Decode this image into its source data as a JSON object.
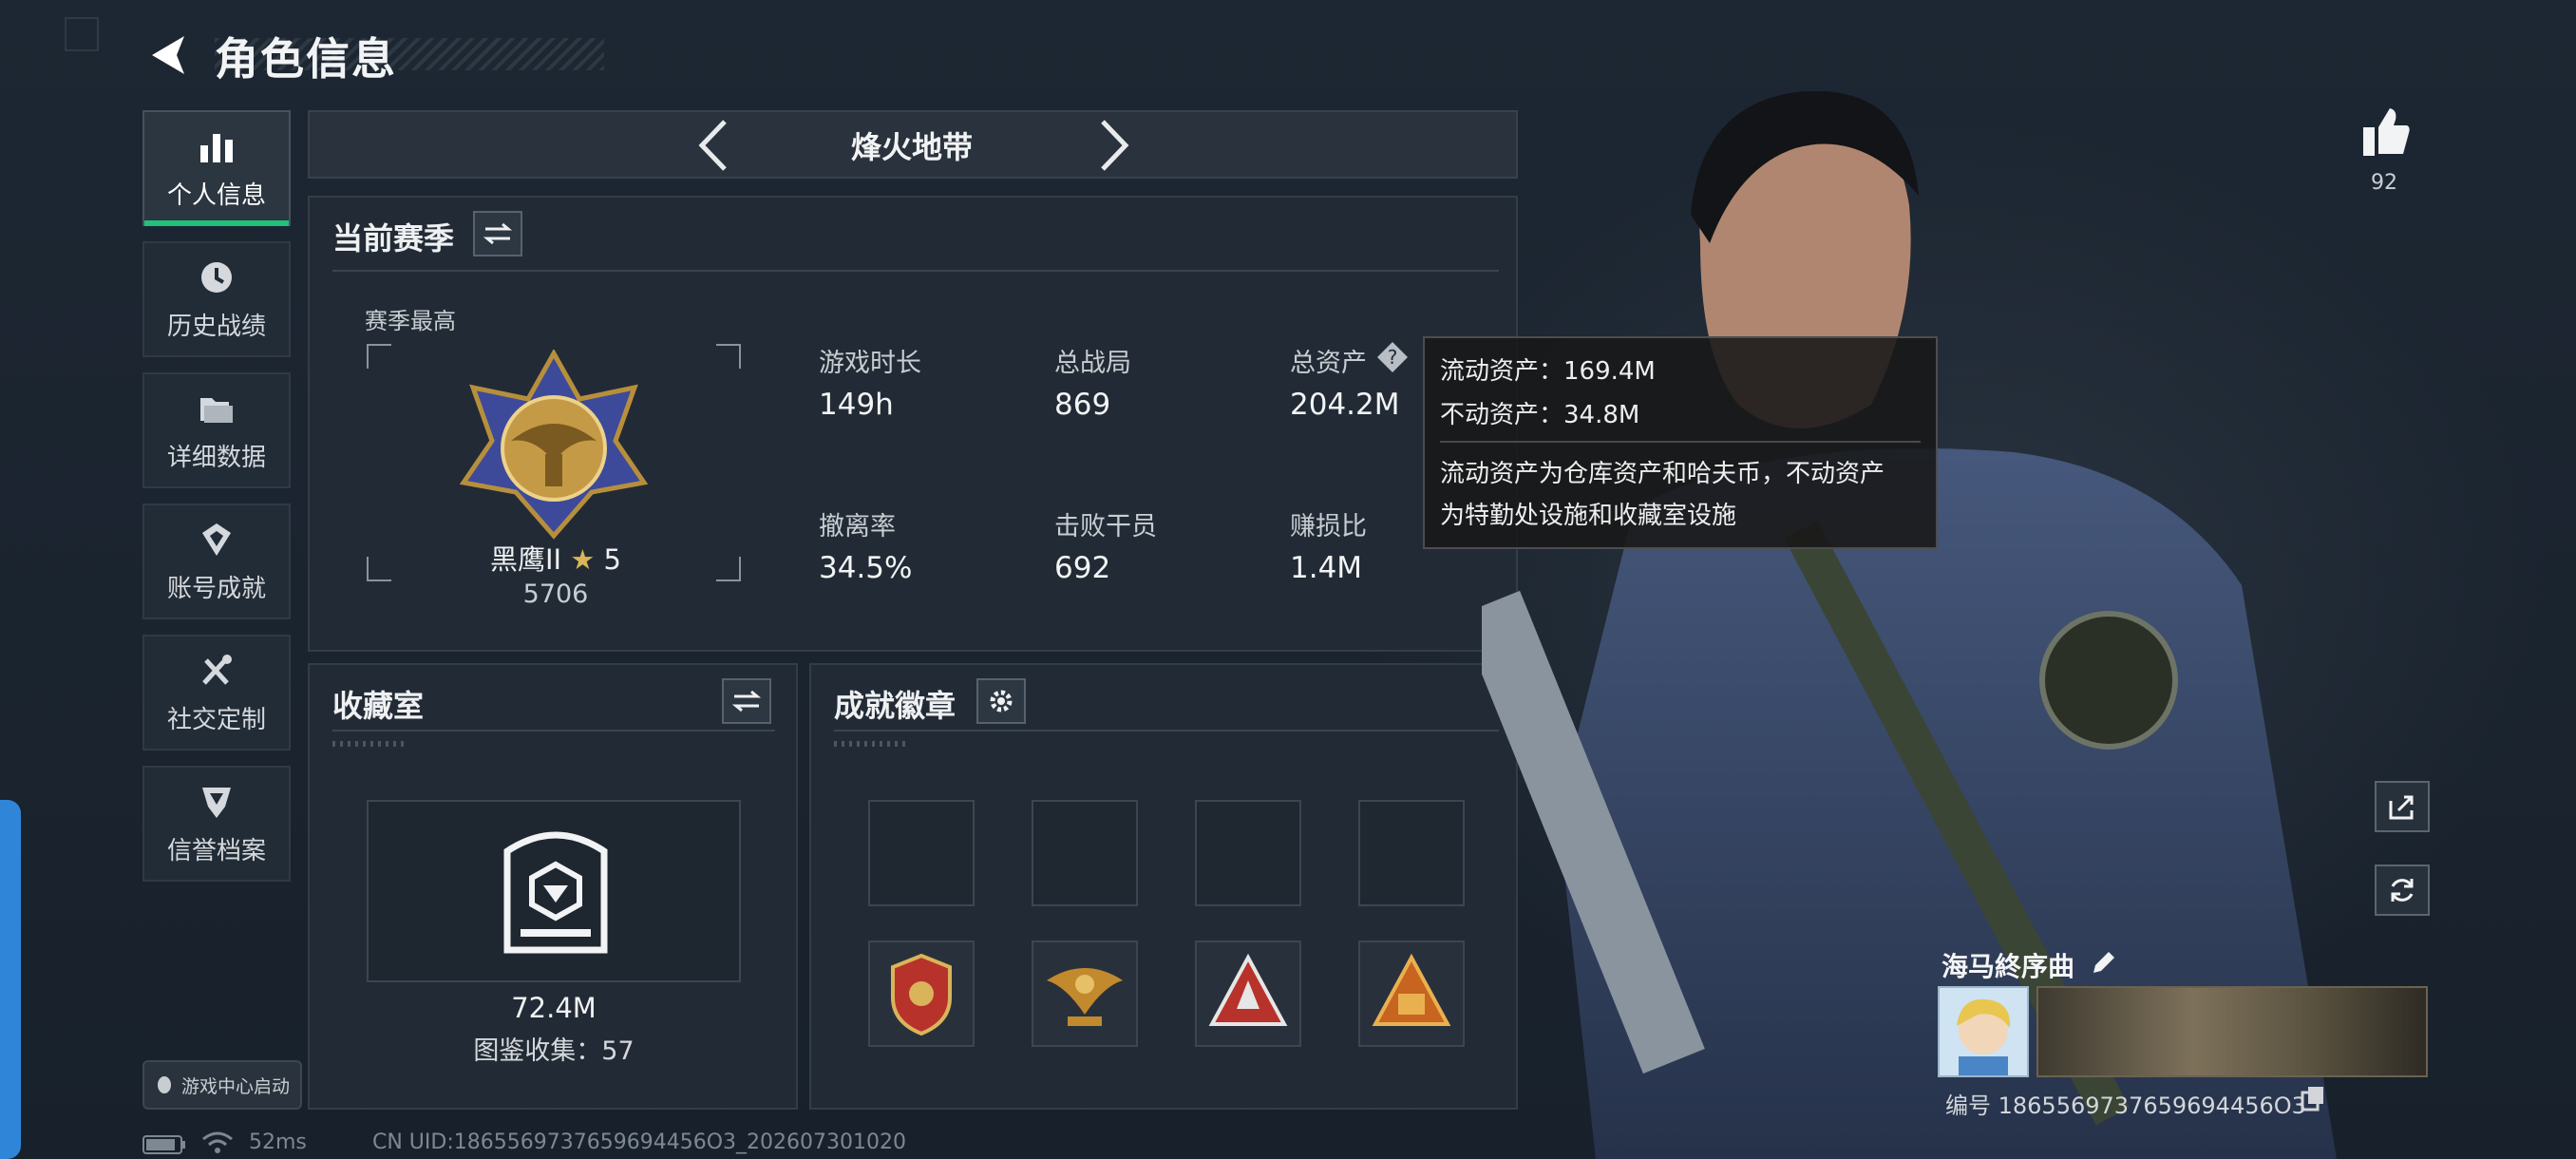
{
  "header": {
    "title": "角色信息"
  },
  "sidebar": {
    "items": [
      {
        "label": "个人信息",
        "icon": "bar-chart-icon",
        "active": true
      },
      {
        "label": "历史战绩",
        "icon": "clock-history-icon",
        "active": false
      },
      {
        "label": "详细数据",
        "icon": "folder-icon",
        "active": false
      },
      {
        "label": "账号成就",
        "icon": "achievement-icon",
        "active": false
      },
      {
        "label": "社交定制",
        "icon": "tools-icon",
        "active": false
      },
      {
        "label": "信誉档案",
        "icon": "credit-shield-icon",
        "active": false
      }
    ],
    "bottom_button": "游戏中心启动"
  },
  "mode": {
    "title": "烽火地带"
  },
  "season": {
    "title": "当前赛季",
    "highest_label": "赛季最高",
    "rank_name": "黑鹰II",
    "rank_stars": "5",
    "rank_score": "5706",
    "stats": [
      {
        "label": "游戏时长",
        "value": "149h"
      },
      {
        "label": "总战局",
        "value": "869"
      },
      {
        "label": "总资产",
        "value": "204.2M"
      },
      {
        "label": "撤离率",
        "value": "34.5%"
      },
      {
        "label": "击败干员",
        "value": "692"
      },
      {
        "label": "赚损比",
        "value": "1.4M"
      }
    ]
  },
  "tooltip": {
    "line1": "流动资产：169.4M",
    "line2": "不动资产：34.8M",
    "desc1": "流动资产为仓库资产和哈夫币，不动资产",
    "desc2": "为特勤处设施和收藏室设施"
  },
  "collection": {
    "title": "收藏室",
    "value": "72.4M",
    "gallery": "图鉴收集：57"
  },
  "badges": {
    "title": "成就徽章",
    "empty_slots": 4,
    "filled_slots": 4
  },
  "profile": {
    "likes": "92",
    "nickname": "海马終序曲",
    "uid_line": "编号 1865569737659694456O3"
  },
  "status_bar": {
    "ping": "52ms",
    "uid": "CN UID:1865569737659694456O3_202607301020"
  },
  "colors": {
    "accent_green": "#22c07a",
    "panel_bg": "#222b35",
    "tab_blue": "#2f86d8"
  }
}
